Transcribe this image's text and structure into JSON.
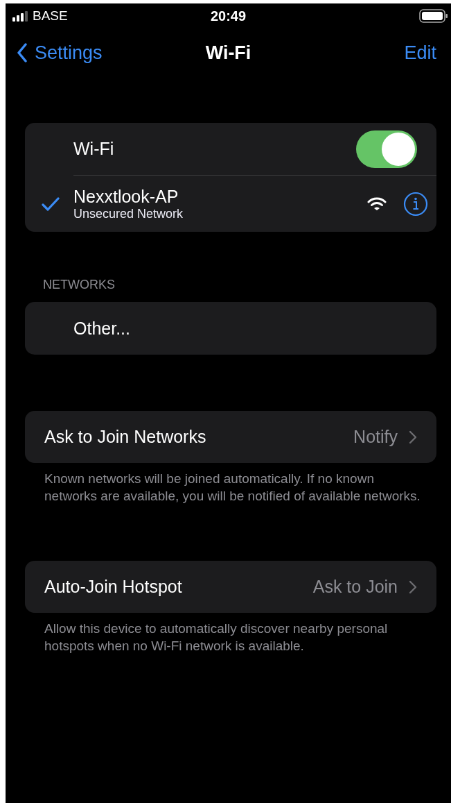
{
  "status_bar": {
    "carrier": "BASE",
    "time": "20:49"
  },
  "nav": {
    "back": "Settings",
    "title": "Wi-Fi",
    "action": "Edit"
  },
  "wifi": {
    "label": "Wi-Fi",
    "on": true
  },
  "current_network": {
    "name": "Nexxtlook-AP",
    "subtitle": "Unsecured Network",
    "checked": true
  },
  "networks": {
    "header": "NETWORKS",
    "items": [
      {
        "label": "Other..."
      }
    ]
  },
  "settings": [
    {
      "label": "Ask to Join Networks",
      "value": "Notify",
      "footer": "Known networks will be joined automatically. If no known networks are available, you will be notified of available networks."
    },
    {
      "label": "Auto-Join Hotspot",
      "value": "Ask to Join",
      "footer": "Allow this device to automatically discover nearby personal hotspots when no Wi-Fi network is available."
    }
  ]
}
